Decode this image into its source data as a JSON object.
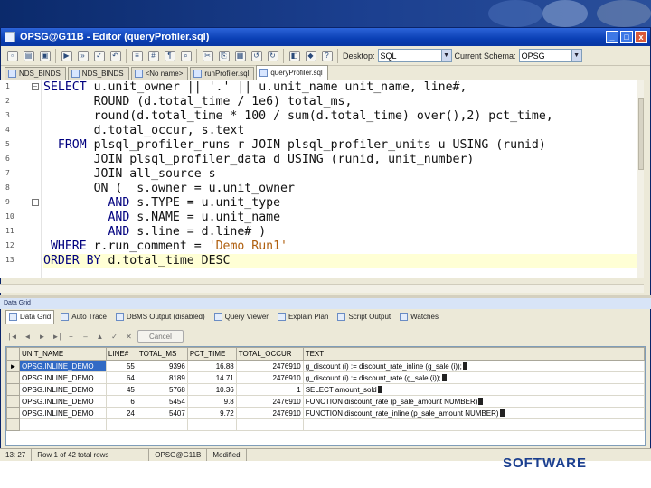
{
  "window": {
    "title": "OPSG@G11B - Editor (queryProfiler.sql)",
    "controls": [
      "_",
      "□",
      "x"
    ]
  },
  "toolbar": {
    "desktop_label": "Desktop:",
    "desktop_value": "SQL",
    "schema_label": "Current Schema:",
    "schema_value": "OPSG"
  },
  "editor_tabs": [
    {
      "label": "NDS_BINDS",
      "active": false
    },
    {
      "label": "NDS_BINDS",
      "active": false
    },
    {
      "label": "<No name>",
      "active": false
    },
    {
      "label": "runProfiler.sql",
      "active": false
    },
    {
      "label": "queryProfiler.sql",
      "active": true
    }
  ],
  "editor": {
    "line_numbers": [
      "1",
      "2",
      "3",
      "4",
      "5",
      "6",
      "7",
      "8",
      "9",
      "10",
      "11",
      "12",
      "13"
    ]
  },
  "data_grid": {
    "title": "Data Grid",
    "tabs": [
      {
        "label": "Data Grid",
        "active": true
      },
      {
        "label": "Auto Trace",
        "active": false
      },
      {
        "label": "DBMS Output (disabled)",
        "active": false
      },
      {
        "label": "Query Viewer",
        "active": false
      },
      {
        "label": "Explain Plan",
        "active": false
      },
      {
        "label": "Script Output",
        "active": false
      },
      {
        "label": "Watches",
        "active": false
      }
    ],
    "nav_buttons": [
      "|◄",
      "◄",
      "►",
      "►|",
      "+",
      "–",
      "▲",
      "✓",
      "✕"
    ],
    "cancel_label": "Cancel",
    "columns": [
      "UNIT_NAME",
      "LINE#",
      "TOTAL_MS",
      "PCT_TIME",
      "TOTAL_OCCUR",
      "TEXT"
    ],
    "rows": [
      {
        "marker": "►",
        "unit_name": "OPSG.INLINE_DEMO",
        "line": "55",
        "total_ms": "9396",
        "pct_time": "16.88",
        "total_occur": "2476910",
        "text": "g_discount (i) := discount_rate_inline (g_sale (i));"
      },
      {
        "marker": "",
        "unit_name": "OPSG.INLINE_DEMO",
        "line": "64",
        "total_ms": "8189",
        "pct_time": "14.71",
        "total_occur": "2476910",
        "text": "g_discount (i) := discount_rate (g_sale (i));"
      },
      {
        "marker": "",
        "unit_name": "OPSG.INLINE_DEMO",
        "line": "45",
        "total_ms": "5768",
        "pct_time": "10.36",
        "total_occur": "1",
        "text": "SELECT amount_sold"
      },
      {
        "marker": "",
        "unit_name": "OPSG.INLINE_DEMO",
        "line": "6",
        "total_ms": "5454",
        "pct_time": "9.8",
        "total_occur": "2476910",
        "text": "FUNCTION discount_rate (p_sale_amount NUMBER)"
      },
      {
        "marker": "",
        "unit_name": "OPSG.INLINE_DEMO",
        "line": "24",
        "total_ms": "5407",
        "pct_time": "9.72",
        "total_occur": "2476910",
        "text": "FUNCTION discount_rate_inline (p_sale_amount NUMBER)"
      },
      {
        "marker": "",
        "unit_name": "",
        "line": "",
        "total_ms": "",
        "pct_time": "",
        "total_occur": "",
        "text": ""
      }
    ]
  },
  "status_bar": {
    "position": "13: 27",
    "rows_info": "Row 1 of 42 total rows",
    "connection": "OPSG@G11B",
    "state": "Modified"
  },
  "footer": {
    "logo_text": "SOFTWARE"
  },
  "colors": {
    "keyword": "#00007f",
    "string": "#b06010",
    "selection": "#316ac5",
    "title_bar": "#0a3fb4"
  }
}
